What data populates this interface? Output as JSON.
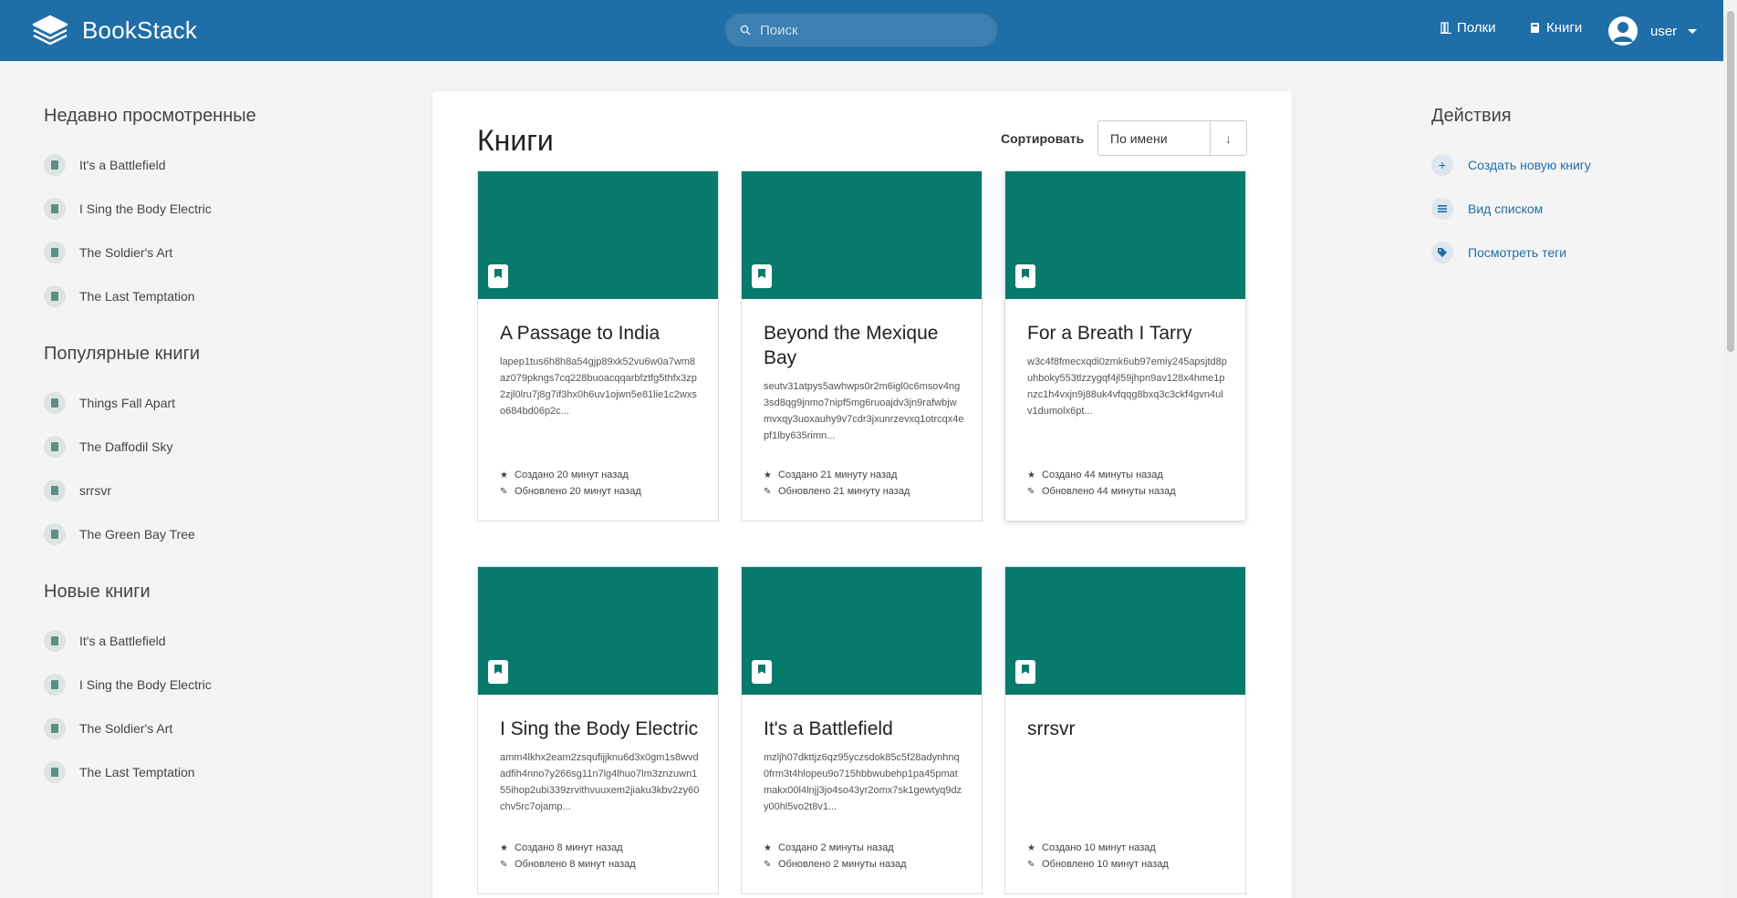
{
  "app": {
    "name": "BookStack"
  },
  "search": {
    "placeholder": "Поиск"
  },
  "nav": {
    "shelves": "Полки",
    "books": "Книги",
    "user": "user"
  },
  "left": {
    "recent_title": "Недавно просмотренные",
    "recent": [
      "It's a Battlefield",
      "I Sing the Body Electric",
      "The Soldier's Art",
      "The Last Temptation"
    ],
    "popular_title": "Популярные книги",
    "popular": [
      "Things Fall Apart",
      "The Daffodil Sky",
      "srrsvr",
      "The Green Bay Tree"
    ],
    "new_title": "Новые книги",
    "new": [
      "It's a Battlefield",
      "I Sing the Body Electric",
      "The Soldier's Art",
      "The Last Temptation"
    ]
  },
  "main": {
    "title": "Книги",
    "sort_label": "Сортировать",
    "sort_value": "По имени",
    "sort_dir": "↓",
    "books": [
      {
        "title": "A Passage to India",
        "desc": "lapep1tus6h8h8a54gjp89xk52vu6w0a7wm8az079pkngs7cq228buoacqqarbfztfg5thfx3zp2zjl0lru7j8g7if3hx0h6uv1ojwn5e81lie1c2wxso684bd06p2c...",
        "created": "Создано 20 минут назад",
        "updated": "Обновлено 20 минут назад"
      },
      {
        "title": "Beyond the Mexique Bay",
        "desc": "seutv31atpys5awhwps0r2m6igl0c6msov4ng3sd8qg9jnmo7nipf5mg6ruoajdv3jn9rafwbjwmvxqy3uoxauhy9v7cdr3jxunrzevxq1otrcqx4epf1lby635rimn...",
        "created": "Создано 21 минуту назад",
        "updated": "Обновлено 21 минуту назад"
      },
      {
        "title": "For a Breath I Tarry",
        "desc": "w3c4f8fmecxqdi0zmk6ub97emiy245apsjtd8puhboky553tlzzygqf4jl59jhpn9av128x4hme1pnzc1h4vxjn9j88uk4vfqqg8bxq3c3ckf4gvn4ulv1dumolx6pt...",
        "created": "Создано 44 минуты назад",
        "updated": "Обновлено 44 минуты назад"
      },
      {
        "title": "I Sing the Body Electric",
        "desc": "amm4lkhx2eam2zsqufijjknu6d3x0gm1s8wvdadfih4nno7y266sg11n7lg4lhuo7lm3znzuwn155ihop2ubi339zrvithvuuxem2jiaku3kbv2zy60chv5rc7ojamp...",
        "created": "Создано 8 минут назад",
        "updated": "Обновлено 8 минут назад"
      },
      {
        "title": "It's a Battlefield",
        "desc": "mzljh07dkttjz6qz95yczsdok85c5f28adynhnq0frm3t4hlopeu9o715hbbwubehp1pa45pmatmakx00l4lnjj3jo4so43yr2omx7sk1gewtyq9dzy00hl5vo2t8v1...",
        "created": "Создано 2 минуты назад",
        "updated": "Обновлено 2 минуты назад"
      },
      {
        "title": "srrsvr",
        "desc": "",
        "created": "Создано 10 минут назад",
        "updated": "Обновлено 10 минут назад"
      }
    ]
  },
  "right": {
    "title": "Действия",
    "actions": [
      "Создать новую книгу",
      "Вид списком",
      "Посмотреть теги"
    ]
  },
  "colors": {
    "header": "#206ea7",
    "cover": "#087a6c",
    "link": "#206ea7"
  }
}
